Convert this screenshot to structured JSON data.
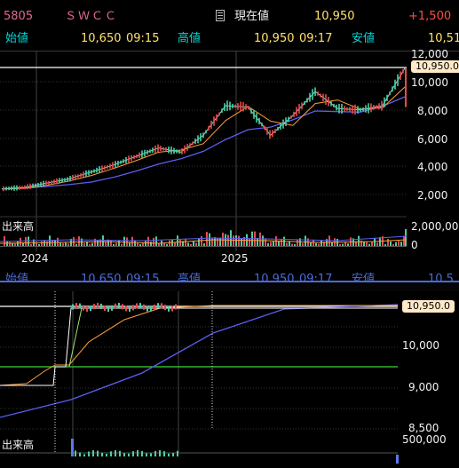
{
  "header": {
    "code": "5805",
    "name": "ＳＷＣＣ",
    "current_label": "現在値",
    "current_value": "10,950",
    "change": "+1,500",
    "row2": {
      "open_label": "始値",
      "open_value": "10,650",
      "open_time": "09:15",
      "high_label": "高値",
      "high_value": "10,950",
      "high_time": "09:17",
      "low_label": "安値",
      "low_value": "10,51"
    },
    "ghost_row": {
      "open_label": "始値",
      "open_value": "10,650",
      "open_time": "09:15",
      "high_label": "高値",
      "high_value": "10,950",
      "high_time": "09:17",
      "low_label": "安値",
      "low_value": "10,5"
    }
  },
  "top_chart": {
    "price_tag": "10,950.0",
    "y_ticks": [
      "12,000",
      "10,000",
      "8,000",
      "6,000",
      "4,000",
      "2,000"
    ],
    "volume_label": "出来高",
    "volume_tick": "2,000,000",
    "volume_zero": "0",
    "x_labels": [
      "2024",
      "2025"
    ]
  },
  "bottom_chart": {
    "price_tag": "10,950.0",
    "y_ticks": [
      "10,000",
      "9,000",
      "8,500"
    ],
    "volume_label": "出来高",
    "volume_tick": "500,000"
  },
  "chart_data": [
    {
      "type": "line",
      "title": "",
      "x_labels": [
        "2024",
        "2025"
      ],
      "y_ticks": [
        2000,
        4000,
        6000,
        8000,
        10000,
        12000
      ],
      "ylim": [
        1000,
        12800
      ],
      "series": [
        {
          "values": [
            2400,
            2500,
            2800,
            3100,
            3600,
            4100,
            4700,
            5300,
            5000,
            6200,
            8300,
            8200,
            6200,
            7600,
            9300,
            8100,
            8000,
            8300,
            10950
          ]
        }
      ],
      "horizontal_line": 10950,
      "colors": {
        "price": "#e94b4b",
        "ma_short": "#ff9f3a",
        "ma_long": "#5a5ef0"
      }
    },
    {
      "type": "line",
      "title": "",
      "y_ticks": [
        8500,
        9000,
        10000
      ],
      "horizontal_line": 10950
    }
  ]
}
